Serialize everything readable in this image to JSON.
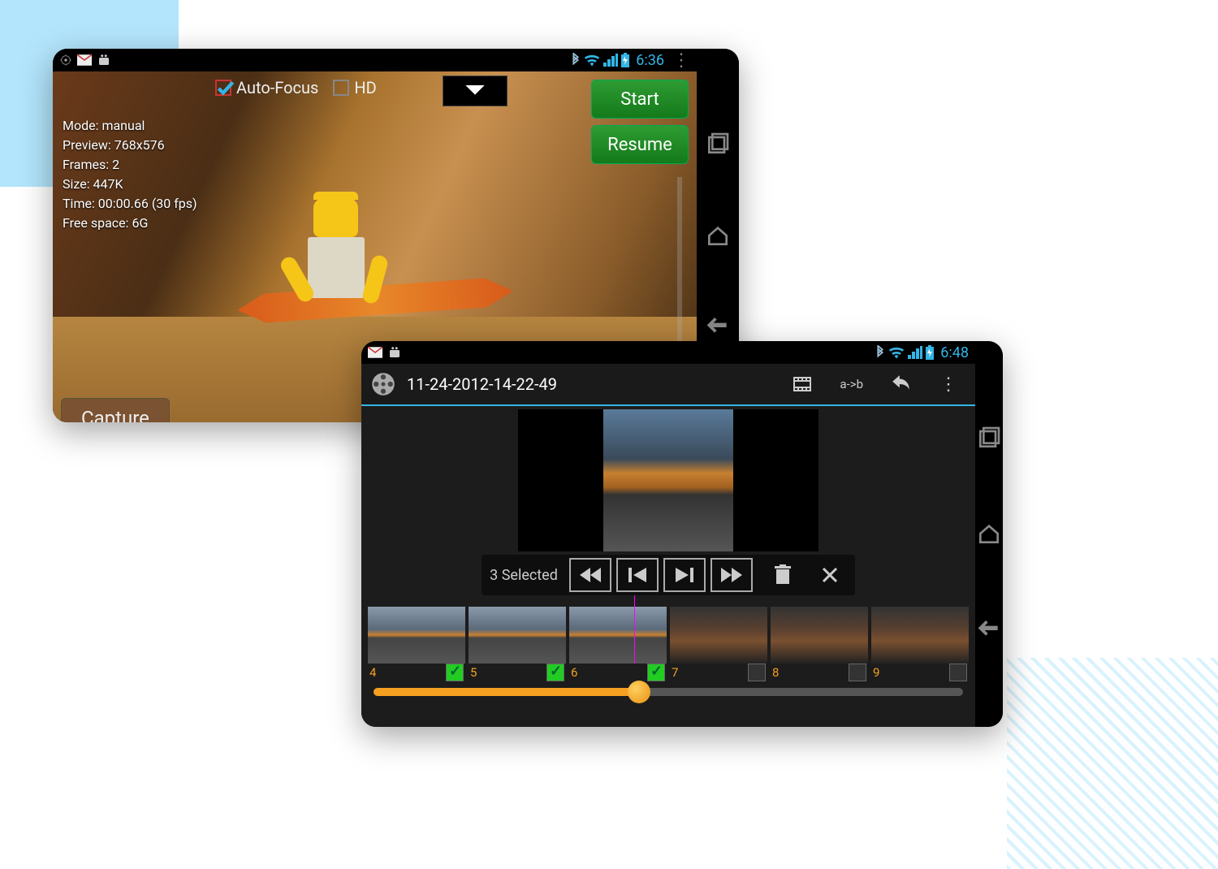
{
  "phone1": {
    "statusbar": {
      "time": "6:36"
    },
    "options": {
      "autofocus_label": "Auto-Focus",
      "hd_label": "HD"
    },
    "stats": {
      "mode": "Mode: manual",
      "preview": "Preview: 768x576",
      "frames": "Frames: 2",
      "size": "Size: 447K",
      "time": "Time: 00:00.66 (30 fps)",
      "free": "Free space: 6G"
    },
    "buttons": {
      "start": "Start",
      "resume": "Resume",
      "capture": "Capture"
    }
  },
  "phone2": {
    "statusbar": {
      "time": "6:48"
    },
    "title": "11-24-2012-14-22-49",
    "ab_label": "a->b",
    "selected_text": "3 Selected",
    "thumbs": [
      {
        "n": "4",
        "checked": true
      },
      {
        "n": "5",
        "checked": true
      },
      {
        "n": "6",
        "checked": true
      },
      {
        "n": "7",
        "checked": false
      },
      {
        "n": "8",
        "checked": false
      },
      {
        "n": "9",
        "checked": false
      }
    ]
  }
}
